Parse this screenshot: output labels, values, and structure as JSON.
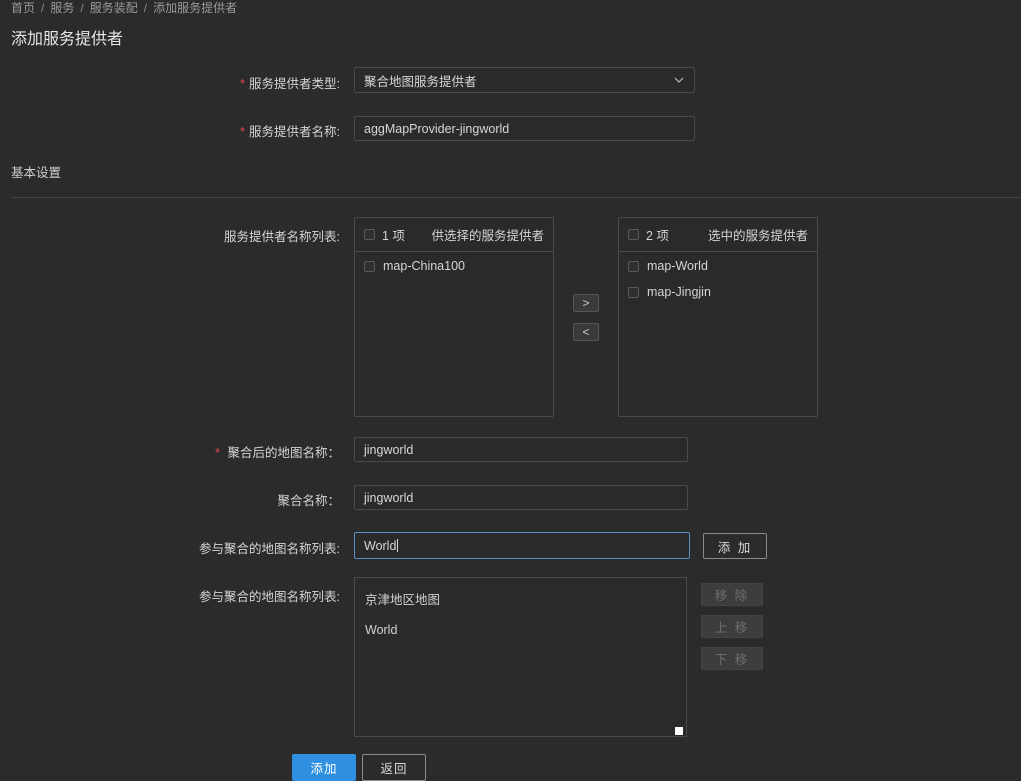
{
  "breadcrumb": [
    "首页",
    "服务",
    "服务装配",
    "添加服务提供者"
  ],
  "page_title": "添加服务提供者",
  "form": {
    "provider_type": {
      "label": "服务提供者类型:",
      "value": "聚合地图服务提供者"
    },
    "provider_name": {
      "label": "服务提供者名称:",
      "value": "aggMapProvider-jingworld"
    },
    "section_basic": "基本设置",
    "provider_list_label": "服务提供者名称列表:",
    "transfer": {
      "left": {
        "count": "1 项",
        "title": "供选择的服务提供者",
        "items": [
          "map-China100"
        ]
      },
      "right": {
        "count": "2 项",
        "title": "选中的服务提供者",
        "items": [
          "map-World",
          "map-Jingjin"
        ]
      },
      "to_right": ">",
      "to_left": "<"
    },
    "agg_map_name": {
      "label": "聚合后的地图名称：",
      "value": "jingworld"
    },
    "agg_name": {
      "label": "聚合名称：",
      "value": "jingworld"
    },
    "participating_input": {
      "label": "参与聚合的地图名称列表:",
      "value": "World",
      "add_button": "添 加"
    },
    "participating_list": {
      "label": "参与聚合的地图名称列表:",
      "items": [
        "京津地区地图",
        "World"
      ],
      "remove_button": "移 除",
      "up_button": "上 移",
      "down_button": "下 移"
    }
  },
  "footer": {
    "submit": "添加",
    "back": "返回"
  }
}
